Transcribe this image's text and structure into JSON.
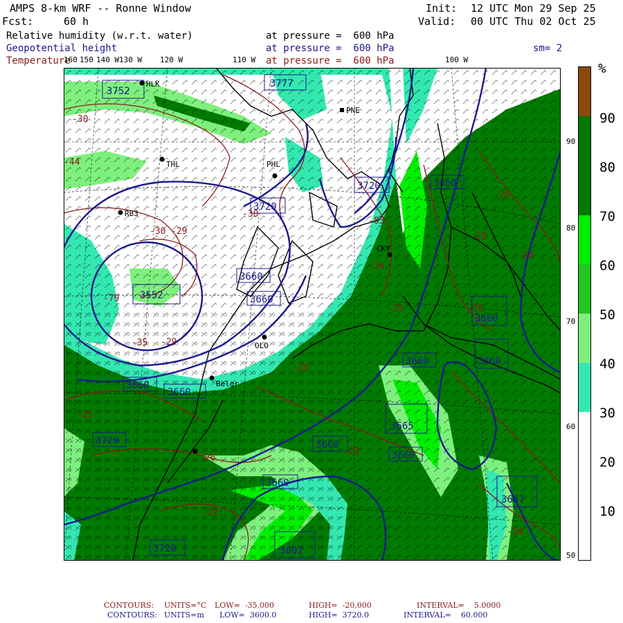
{
  "header": {
    "model": "AMPS 8-km WRF -- Ronne Window",
    "forecast_label": "Fcst:",
    "forecast_hours": "60 h",
    "init_label": "Init:",
    "init_time": "12 UTC Mon 29 Sep 25",
    "valid_label": "Valid:",
    "valid_time": "00 UTC Thu 02 Oct 25",
    "smoothing": "sm= 2"
  },
  "fields": [
    {
      "name": "Relative humidity (w.r.t. water)",
      "level": "at pressure =  600 hPa",
      "color": "#000000"
    },
    {
      "name": "Geopotential height",
      "level": "at pressure =  600 hPa",
      "color": "#1a1a8c"
    },
    {
      "name": "Temperature",
      "level": "at pressure =  600 hPa",
      "color": "#8b1a1a"
    }
  ],
  "lon_labels": [
    "160",
    "150",
    "140 W",
    "130 W",
    "120 W",
    "110 W",
    "100 W"
  ],
  "lat_labels": [
    "90 N",
    "80 N",
    "70 N",
    "60 N",
    "50 N"
  ],
  "colorbar": {
    "unit": "%",
    "ticks": [
      "90",
      "80",
      "70",
      "60",
      "50",
      "40",
      "30",
      "20",
      "10"
    ],
    "bands": [
      {
        "from": 90,
        "to": 100,
        "color": "#8b4a0c"
      },
      {
        "from": 70,
        "to": 90,
        "color": "#007a00"
      },
      {
        "from": 60,
        "to": 70,
        "color": "#00ee00"
      },
      {
        "from": 50,
        "to": 60,
        "color": "#22c522"
      },
      {
        "from": 40,
        "to": 50,
        "color": "#7ef07e"
      },
      {
        "from": 30,
        "to": 40,
        "color": "#33e8b0"
      },
      {
        "from": 0,
        "to": 30,
        "color": "#ffffff"
      }
    ]
  },
  "height_labels": [
    "3752",
    "3777",
    "3720",
    "3720",
    "3660",
    "3660",
    "3552",
    "3660",
    "3660",
    "3720",
    "3660",
    "3660",
    "3665",
    "3660",
    "3667",
    "3660",
    "3602",
    "3720",
    "3660",
    "3660",
    "3660"
  ],
  "temp_labels": [
    "-30",
    "-44",
    "-30",
    "-29",
    "-79",
    "-35",
    "-30",
    "-25",
    "-25",
    "-26",
    "-22",
    "-22",
    "-24",
    "-24",
    "-25",
    "-29",
    "-83",
    "-29",
    "-25",
    "-26",
    "-25"
  ],
  "stations": [
    "HLK",
    "PNE",
    "THL",
    "PHL",
    "RB3",
    "CKY",
    "OLO",
    "Belgr"
  ],
  "footer": {
    "temp": {
      "label": "CONTOURS:",
      "units": "UNITS=°C",
      "low": "LOW=  -35.000",
      "high": "HIGH=  -20.000",
      "interval": "INTERVAL=    5.0000"
    },
    "height": {
      "label": "CONTOURS:",
      "units": "UNITS=m",
      "low": "LOW=  3600.0",
      "high": "HIGH=  3720.0",
      "interval": "INTERVAL=    60.000"
    }
  }
}
